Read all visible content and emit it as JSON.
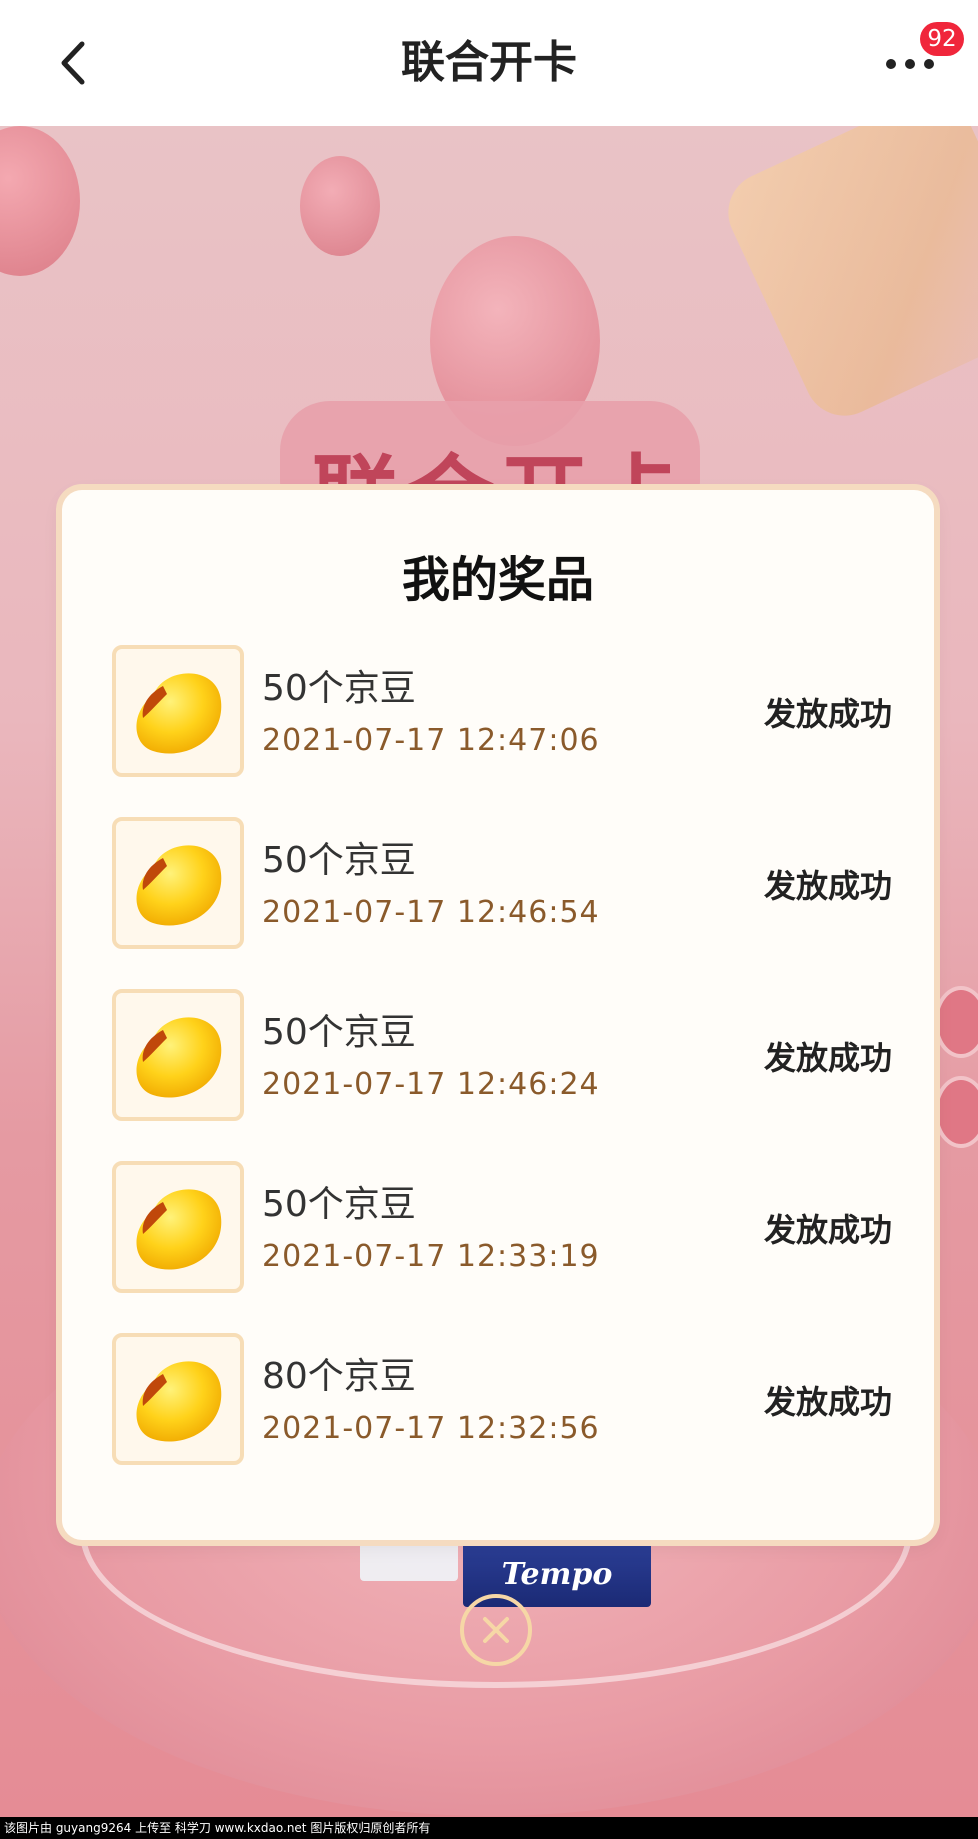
{
  "header": {
    "title": "联合开卡",
    "badge_count": "92",
    "back_icon": "chevron-left-icon",
    "more_icon": "more-dots-icon"
  },
  "background": {
    "banner_text": "联合开卡",
    "product_label": "Tempo"
  },
  "modal": {
    "title": "我的奖品",
    "prizes": [
      {
        "name": "50个京豆",
        "time": "2021-07-17 12:47:06",
        "status": "发放成功",
        "icon": "jd-bean-icon"
      },
      {
        "name": "50个京豆",
        "time": "2021-07-17 12:46:54",
        "status": "发放成功",
        "icon": "jd-bean-icon"
      },
      {
        "name": "50个京豆",
        "time": "2021-07-17 12:46:24",
        "status": "发放成功",
        "icon": "jd-bean-icon"
      },
      {
        "name": "50个京豆",
        "time": "2021-07-17 12:33:19",
        "status": "发放成功",
        "icon": "jd-bean-icon"
      },
      {
        "name": "80个京豆",
        "time": "2021-07-17 12:32:56",
        "status": "发放成功",
        "icon": "jd-bean-icon"
      }
    ],
    "close_icon": "close-circle-icon"
  },
  "footer": {
    "text": "该图片由 guyang9264 上传至 科学刀 www.kxdao.net 图片版权归原创者所有"
  },
  "colors": {
    "badge": "#f0263b",
    "time_text": "#8a5a2b",
    "modal_border": "#f5dbc0"
  }
}
